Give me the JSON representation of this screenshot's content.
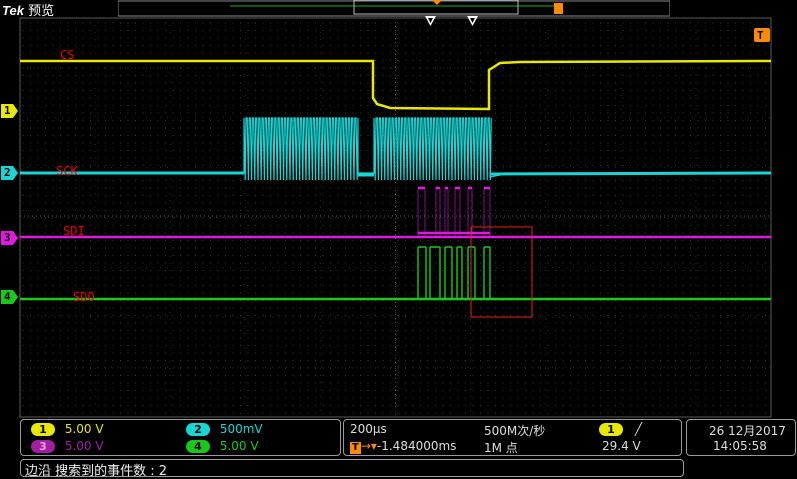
{
  "header": {
    "brand": "Tek",
    "mode": "预览"
  },
  "trigger": {
    "marker": "T"
  },
  "channels": [
    {
      "num": "1",
      "label": "CS",
      "color": "#e8e800",
      "scale": "5.00 V"
    },
    {
      "num": "2",
      "label": "SCK",
      "color": "#19d6d6",
      "scale": "500mV"
    },
    {
      "num": "3",
      "label": "SDI",
      "color": "#e019e0",
      "scale": "5.00 V"
    },
    {
      "num": "4",
      "label": "SDO",
      "color": "#19c819",
      "scale": "5.00 V"
    }
  ],
  "timebase": {
    "scale": "200µs",
    "sample_rate": "500M次/秒",
    "delay": "-1.484000ms",
    "record_length": "1M 点"
  },
  "trigger_readout": {
    "channel": "1",
    "slope": "╱",
    "level": "29.4 V"
  },
  "datetime": {
    "date": "26 12月2017",
    "time": "14:05:58"
  },
  "status": {
    "text": "边沿 搜索到的事件数 : 2"
  }
}
